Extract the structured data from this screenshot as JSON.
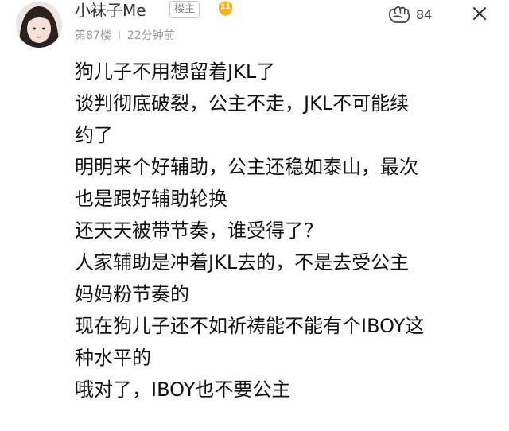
{
  "post": {
    "author": {
      "username": "小袜子Me",
      "op_badge": "楼主",
      "level": "11"
    },
    "meta": {
      "floor": "第87楼",
      "time": "22分钟前"
    },
    "like_count": "84",
    "icons": {
      "like": "like-fist-icon",
      "more": "close-icon"
    },
    "colors": {
      "level_badge": "#f5b51d",
      "text": "#111111",
      "meta": "#999999"
    },
    "content_lines": [
      "狗儿子不用想留着JKL了",
      "谈判彻底破裂，公主不走，JKL不可能续",
      "约了",
      "明明来个好辅助，公主还稳如泰山，最次",
      "也是跟好辅助轮换",
      "还天天被带节奏，谁受得了？",
      "人家辅助是冲着JKL去的，不是去受公主",
      "妈妈粉节奏的",
      "现在狗儿子还不如祈祷能不能有个IBOY这",
      "种水平的",
      "哦对了，IBOY也不要公主"
    ]
  }
}
